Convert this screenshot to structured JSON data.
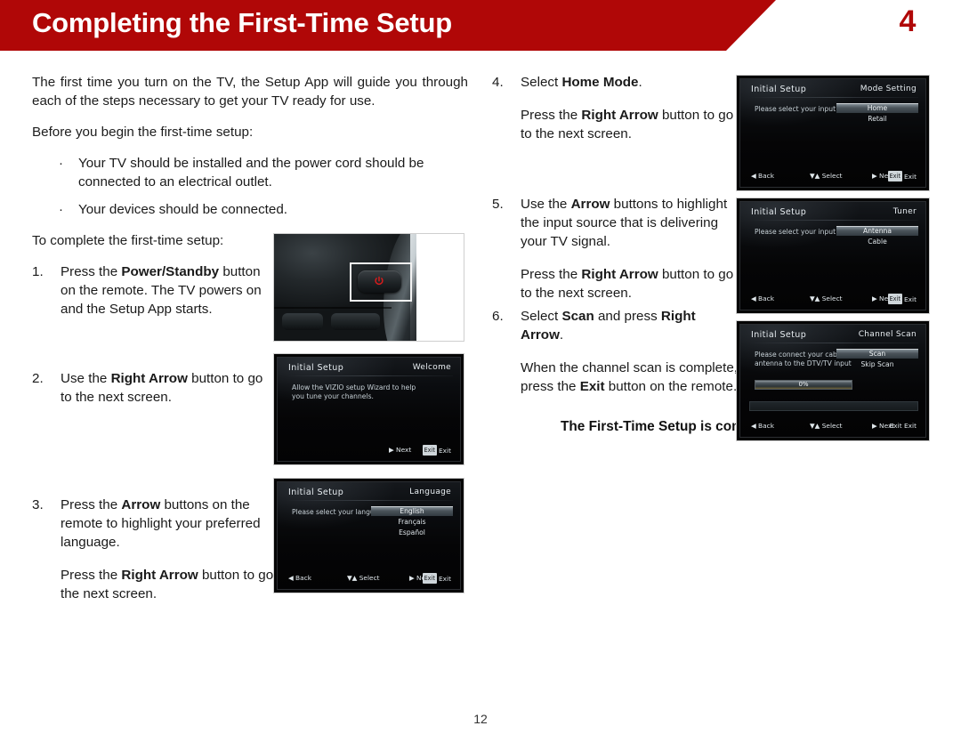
{
  "header": {
    "title": "Completing the First-Time Setup",
    "chapter": "4",
    "band_color": "#b00707"
  },
  "page_number": "12",
  "left_column": {
    "intro": "The first time you turn on the TV, the Setup App will guide you through each of the steps necessary to get your TV ready for use.",
    "before_heading": "Before you begin the first-time setup:",
    "bullets": [
      "Your TV should be installed and the power cord should be connected to an electrical outlet.",
      "Your devices should be connected."
    ],
    "to_complete_heading": "To complete the first-time setup:",
    "steps": [
      {
        "num": "1.",
        "text_parts": [
          "Press the ",
          "Power/Standby",
          " button on the remote. The TV powers on and the Setup App starts."
        ]
      },
      {
        "num": "2.",
        "text_parts": [
          "Use the ",
          "Right Arrow",
          " button to go to the next screen."
        ]
      },
      {
        "num": "3.",
        "text_parts": [
          "Press the ",
          "Arrow",
          " buttons on the remote to highlight your preferred language."
        ],
        "sub_parts": [
          "Press the ",
          "Right Arrow",
          " button to go to the next screen."
        ]
      }
    ]
  },
  "right_column": {
    "steps": [
      {
        "num": "4.",
        "text_parts": [
          "Select ",
          "Home Mode",
          "."
        ],
        "sub_parts": [
          "Press the ",
          "Right Arrow",
          " button to go to the next screen."
        ]
      },
      {
        "num": "5.",
        "text_parts": [
          "Use the ",
          "Arrow",
          " buttons to highlight the input source that is delivering your TV signal."
        ],
        "sub_parts": [
          "Press the ",
          "Right Arrow",
          " button to go to the next screen."
        ]
      },
      {
        "num": "6.",
        "text_parts": [
          "Select ",
          "Scan",
          " and press ",
          "Right Arrow",
          "."
        ],
        "sub_parts": [
          "When the channel scan is complete, press the ",
          "Exit",
          " button on the remote."
        ]
      }
    ],
    "complete_line": "The First-Time Setup is complete."
  },
  "remote_photo": {
    "alt": "remote control power standby button close-up",
    "power_icon": "power-symbol",
    "power_icon_color": "#e01b1b"
  },
  "tv_screens": [
    {
      "id": "welcome",
      "title": "Initial Setup",
      "section": "Welcome",
      "prompt": "Allow the VIZIO setup Wizard to help you tune your channels.",
      "options": [],
      "footer": {
        "back": "",
        "select": "",
        "next": "Next",
        "exit_key": "Exit",
        "exit": "Exit"
      }
    },
    {
      "id": "language",
      "title": "Initial Setup",
      "section": "Language",
      "prompt": "Please select your language:",
      "options": [
        "English",
        "Français",
        "Español"
      ],
      "selected": "English",
      "footer": {
        "back": "Back",
        "select": "Select",
        "next": "Next",
        "exit_key": "Exit",
        "exit": "Exit"
      }
    },
    {
      "id": "mode-setting",
      "title": "Initial Setup",
      "section": "Mode Setting",
      "prompt": "Please select your input location:",
      "options": [
        "Home",
        "Retail"
      ],
      "selected": "Home",
      "footer": {
        "back": "Back",
        "select": "Select",
        "next": "Next",
        "exit_key": "Exit",
        "exit": "Exit"
      }
    },
    {
      "id": "tuner",
      "title": "Initial Setup",
      "section": "Tuner",
      "prompt": "Please select your input source:",
      "options": [
        "Antenna",
        "Cable"
      ],
      "selected": "Antenna",
      "footer": {
        "back": "Back",
        "select": "Select",
        "next": "Next",
        "exit_key": "Exit",
        "exit": "Exit"
      }
    },
    {
      "id": "channel-scan",
      "title": "Initial Setup",
      "section": "Channel Scan",
      "prompt": "Please connect your cable or antenna to the DTV/TV input",
      "options": [
        "Scan",
        "Skip Scan"
      ],
      "selected": "Scan",
      "progress": "0%",
      "footer": {
        "back": "Back",
        "select": "Select",
        "next": "Next",
        "exit_key": "Exit",
        "exit": "Exit"
      }
    }
  ]
}
